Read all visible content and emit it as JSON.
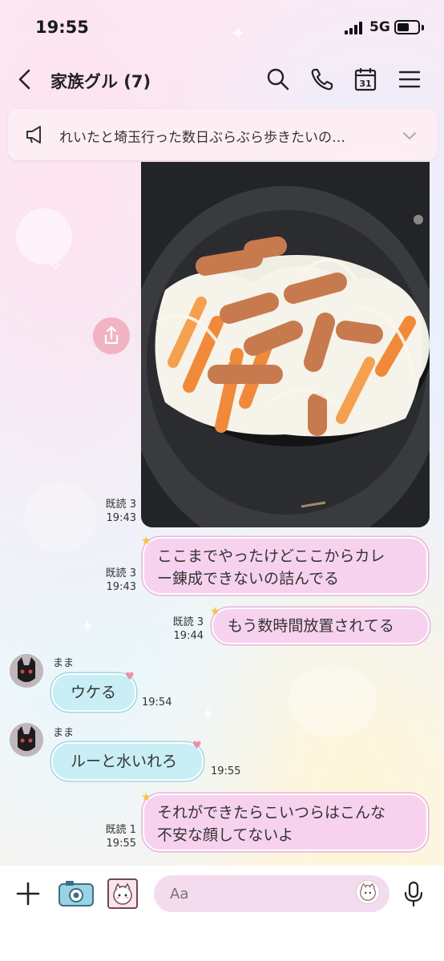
{
  "status": {
    "time": "19:55",
    "network": "5G"
  },
  "header": {
    "title": "家族グル (7)",
    "calendar_day": "31"
  },
  "announcement": {
    "text": "れいたと埼玉行った数日ぶらぶら歩きたいの…"
  },
  "messages": [
    {
      "type": "image",
      "read": "既読 3",
      "time": "19:43"
    },
    {
      "type": "text",
      "read": "既読 3",
      "time": "19:43",
      "lines": [
        "ここまでやったけどここからカレ",
        "ー錬成できないの詰んでる"
      ]
    },
    {
      "type": "text",
      "read": "既読 3",
      "time": "19:44",
      "text": "もう数時間放置されてる"
    },
    {
      "type": "incoming",
      "sender": "まま",
      "text": "ウケる",
      "time": "19:54"
    },
    {
      "type": "incoming",
      "sender": "まま",
      "text": "ルーと水いれろ",
      "time": "19:55"
    },
    {
      "type": "text",
      "read": "既読 1",
      "time": "19:55",
      "lines": [
        "それができたらこいつらはこんな",
        "不安な顔してないよ"
      ]
    }
  ],
  "input": {
    "placeholder": "Aa"
  },
  "colors": {
    "my_bubble": "#f7d2ef",
    "their_bubble": "#c9eef5",
    "input_bg": "#f4dcef"
  }
}
